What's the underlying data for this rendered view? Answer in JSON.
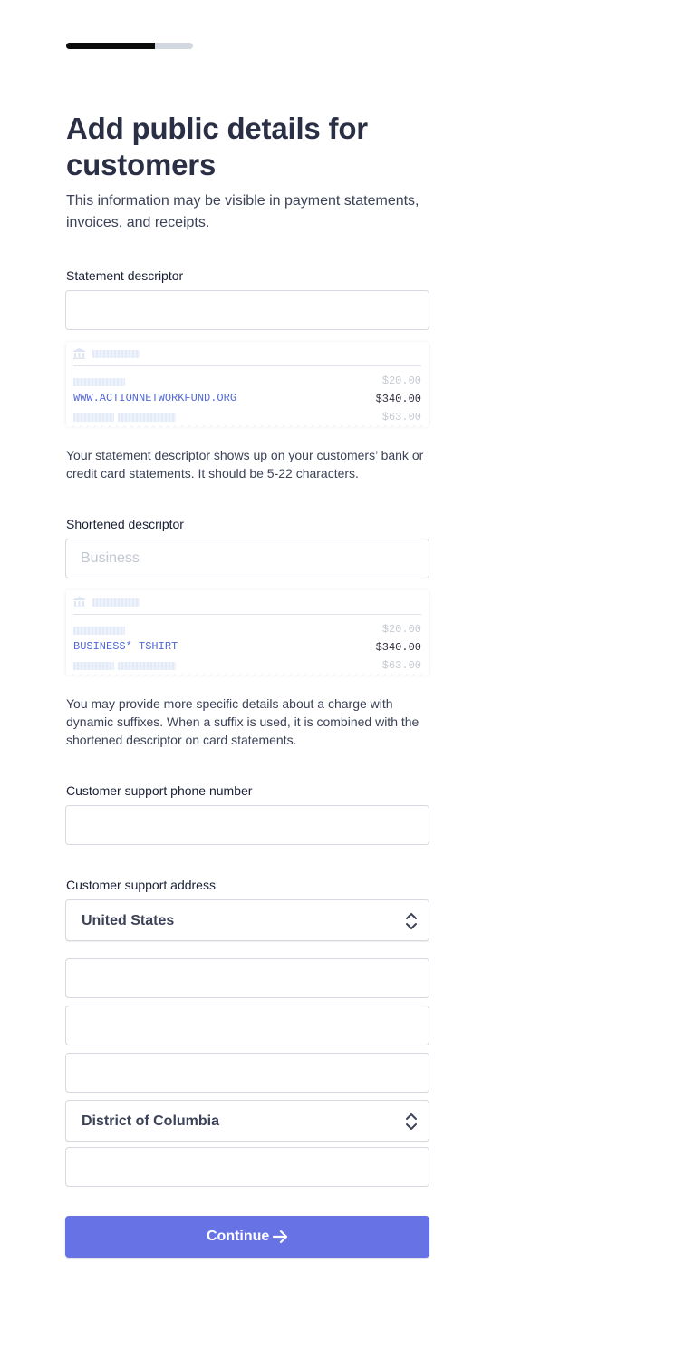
{
  "progress": {
    "percent": 70
  },
  "header": {
    "title": "Add public details for customers",
    "subtitle": "This information may be visible in payment statements, invoices, and receipts."
  },
  "statement_descriptor": {
    "label": "Statement descriptor",
    "value": "",
    "preview": {
      "descriptor": "WWW.ACTIONNETWORKFUND.ORG",
      "amount_top": "$20.00",
      "amount_main": "$340.00",
      "amount_bottom": "$63.00"
    },
    "help": "Your statement descriptor shows up on your customers’ bank or credit card statements. It should be 5-22 characters."
  },
  "shortened_descriptor": {
    "label": "Shortened descriptor",
    "placeholder": "Business",
    "preview": {
      "descriptor": "BUSINESS* TSHIRT",
      "amount_top": "$20.00",
      "amount_main": "$340.00",
      "amount_bottom": "$63.00"
    },
    "help": "You may provide more specific details about a charge with dynamic suffixes. When a suffix is used, it is combined with the shortened descriptor on card statements."
  },
  "support_phone": {
    "label": "Customer support phone number",
    "value": ""
  },
  "support_address": {
    "label": "Customer support address",
    "country": "United States",
    "line1": "",
    "line2": "",
    "city": "",
    "state": "District of Columbia",
    "zip": ""
  },
  "actions": {
    "continue_label": "Continue"
  },
  "colors": {
    "accent": "#6772e5",
    "descriptor_text": "#5469d4",
    "title": "#2a2f45"
  },
  "icons": {
    "bank": "bank-icon",
    "chevron": "chevron-up-down-icon",
    "arrow": "arrow-right-icon"
  }
}
